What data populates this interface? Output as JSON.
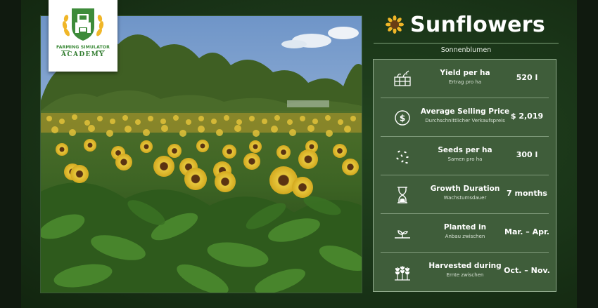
{
  "logo": {
    "line1": "FARMING SIMULATOR",
    "line2": "ACADEMY",
    "icon": "tractor-emblem-icon"
  },
  "header": {
    "title": "Sunflowers",
    "subtitle": "Sonnenblumen",
    "icon": "sunflower-icon"
  },
  "photo": {
    "description_icon": "sunflower-field-photo"
  },
  "stats": [
    {
      "label": "Yield per ha",
      "sublabel": "Ertrag pro ha",
      "value": "520 l",
      "icon": "crate-icon"
    },
    {
      "label": "Average Selling Price",
      "sublabel": "Durchschnittlicher Verkaufspreis",
      "value": "$ 2,019",
      "icon": "dollar-coin-icon"
    },
    {
      "label": "Seeds per ha",
      "sublabel": "Samen pro ha",
      "value": "300 l",
      "icon": "seeds-icon"
    },
    {
      "label": "Growth Duration",
      "sublabel": "Wachstumsdauer",
      "value": "7 months",
      "icon": "hourglass-icon"
    },
    {
      "label": "Planted in",
      "sublabel": "Anbau zwischen",
      "value": "Mar. – Apr.",
      "icon": "sprout-icon"
    },
    {
      "label": "Harvested during",
      "sublabel": "Ernte zwischen",
      "value": "Oct. – Nov.",
      "icon": "wheat-icon"
    }
  ],
  "colors": {
    "background": "#1a3518",
    "panel": "#3f5d3a",
    "logo_green": "#3d8b3a",
    "text": "#ffffff"
  }
}
